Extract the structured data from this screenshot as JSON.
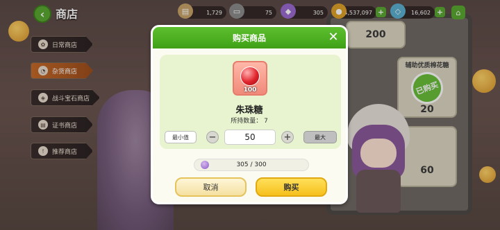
{
  "header": {
    "back_icon": "arrow-left-icon",
    "title": "商店"
  },
  "resources": [
    {
      "icon": "scroll-icon",
      "value": "1,729",
      "color": "#c9a36a"
    },
    {
      "icon": "ticket-icon",
      "value": "75",
      "color": "#8c8c8c"
    },
    {
      "icon": "gem-icon",
      "value": "305",
      "color": "#9a6ad0"
    },
    {
      "icon": "gold-coin-icon",
      "value": "4,537,097",
      "color": "#e0a22a"
    },
    {
      "icon": "diamond-icon",
      "value": "16,602",
      "color": "#5cb0d0"
    }
  ],
  "home_icon": "home-icon",
  "side_menu": [
    {
      "label": "日常商店",
      "icon": "daily-icon",
      "active": false
    },
    {
      "label": "杂货商店",
      "icon": "grocery-icon",
      "active": true
    },
    {
      "label": "战斗宝石商店",
      "icon": "battle-gem-icon",
      "active": false
    },
    {
      "label": "证书商店",
      "icon": "certificate-icon",
      "active": false
    },
    {
      "label": "推荐商店",
      "icon": "recommend-icon",
      "active": false
    }
  ],
  "background_cards": [
    {
      "label": "",
      "value": "200"
    },
    {
      "label": "辅助优质棉花糖",
      "value": "20",
      "stamp": "已购买"
    },
    {
      "label": "",
      "value": "60"
    }
  ],
  "modal": {
    "title": "购买商品",
    "close_icon": "close-icon",
    "item": {
      "icon": "red-candy-icon",
      "count": "100",
      "name": "朱珠糖",
      "owned_label": "所持数量：",
      "owned_value": "7"
    },
    "quantity": {
      "min_label": "最小值",
      "max_label": "最大",
      "value": "50"
    },
    "cost": {
      "icon": "gem-icon",
      "text": "305 / 300"
    },
    "cancel_label": "取消",
    "buy_label": "购买"
  },
  "colors": {
    "accent_green": "#4fb021",
    "buy_yellow": "#f6c01c",
    "active_menu": "#c76a2a"
  }
}
